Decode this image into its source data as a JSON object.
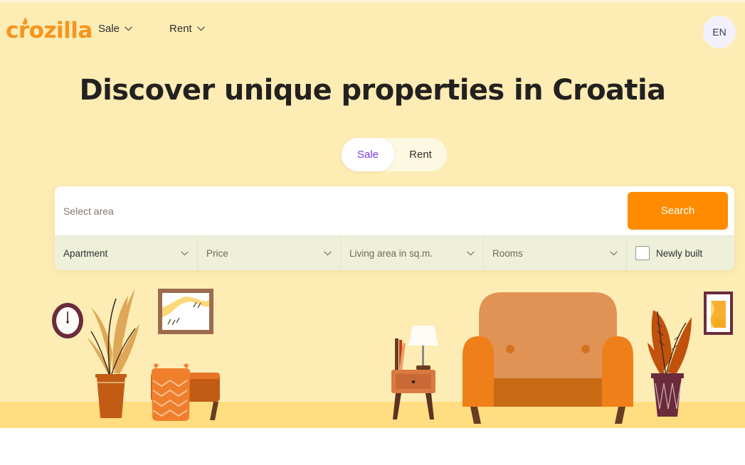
{
  "brand": {
    "logo_text": "crozilla",
    "logo_color": "#f7941d",
    "logo_icon": "flame-icon"
  },
  "header": {
    "nav": [
      {
        "label": "Sale",
        "icon": "chevron-down-icon"
      },
      {
        "label": "Rent",
        "icon": "chevron-down-icon"
      }
    ],
    "language": "EN"
  },
  "hero": {
    "title": "Discover unique properties in Croatia",
    "background_color": "#fdedb4",
    "floor_color": "#ffdd80"
  },
  "deal_toggle": {
    "options": [
      {
        "label": "Sale",
        "active": true
      },
      {
        "label": "Rent",
        "active": false
      }
    ],
    "active_text_color": "#7c3aed"
  },
  "search": {
    "placeholder": "Select area",
    "value": "",
    "button_label": "Search",
    "button_color": "#ff8c00"
  },
  "filters": [
    {
      "label": "Apartment",
      "icon": "chevron-down-icon",
      "selected": true
    },
    {
      "label": "Price",
      "icon": "chevron-down-icon",
      "selected": false
    },
    {
      "label": "Living area in sq.m.",
      "icon": "chevron-down-icon",
      "selected": false
    },
    {
      "label": "Rooms",
      "icon": "chevron-down-icon",
      "selected": false
    }
  ],
  "newly_built": {
    "label": "Newly built",
    "checked": false
  },
  "illustration": {
    "items": [
      "wall-clock",
      "tall-plant-left",
      "framed-landscape-picture",
      "orange-bench-with-cushion",
      "side-table-with-lamp-and-books",
      "orange-sofa",
      "potted-plant-right",
      "framed-abstract-picture"
    ]
  }
}
